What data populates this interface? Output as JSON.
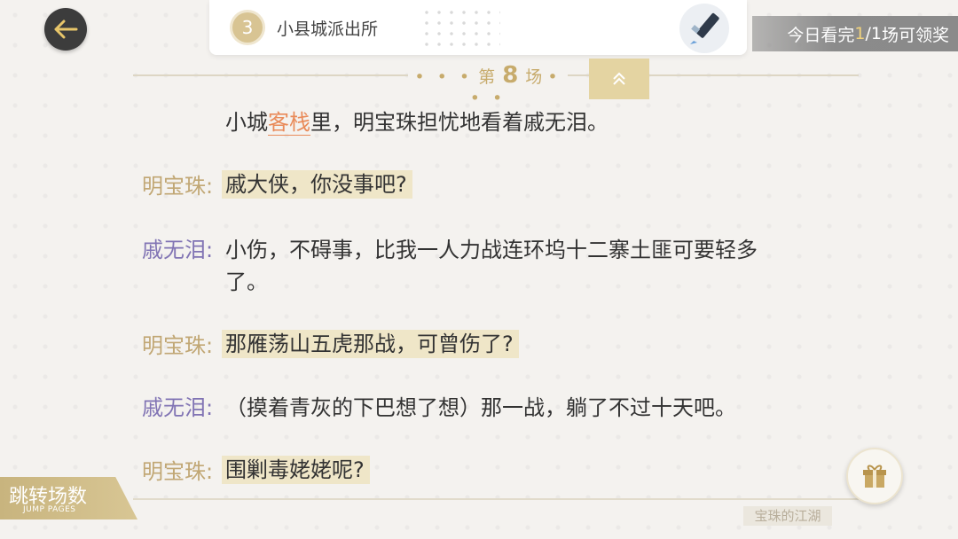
{
  "header": {
    "chapter_number": "3",
    "chapter_title": "小县城派出所",
    "reward_prefix": "今日看完 ",
    "reward_progress": "1",
    "reward_total": "/1",
    "reward_suffix": " 场可领奖"
  },
  "scene": {
    "prefix": "第",
    "number": "8",
    "suffix": "场",
    "dots": "• • •"
  },
  "narration": {
    "before": "小城",
    "keyword": "客栈",
    "after": "里，明宝珠担忧地看着戚无泪。"
  },
  "dialogue": [
    {
      "speaker": "明宝珠:",
      "text": "戚大侠，你没事吧?"
    },
    {
      "speaker": "戚无泪:",
      "text": "小伤，不碍事，比我一人力战连环坞十二寨土匪可要轻多",
      "text2": "了。"
    },
    {
      "speaker": "明宝珠:",
      "text": "那雁荡山五虎那战，可曾伤了?"
    },
    {
      "speaker": "戚无泪:",
      "text": "（摸着青灰的下巴想了想）那一战，躺了不过十天吧。"
    },
    {
      "speaker": "明宝珠:",
      "text": "围剿毒姥姥呢?"
    }
  ],
  "footer": {
    "jump_label": "跳转场数",
    "jump_sub": "JUMP PAGES",
    "watermark": "宝珠的江湖"
  },
  "icons": {
    "back": "arrow-left-icon",
    "pen": "pen-icon",
    "collapse": "chevron-up-icon",
    "gift": "gift-icon"
  },
  "colors": {
    "gold": "#c7ab6c",
    "speaker_ming": "#c1a774",
    "speaker_qi": "#8174b4",
    "keyword": "#e98b5a",
    "highlight": "#efe6c8"
  }
}
